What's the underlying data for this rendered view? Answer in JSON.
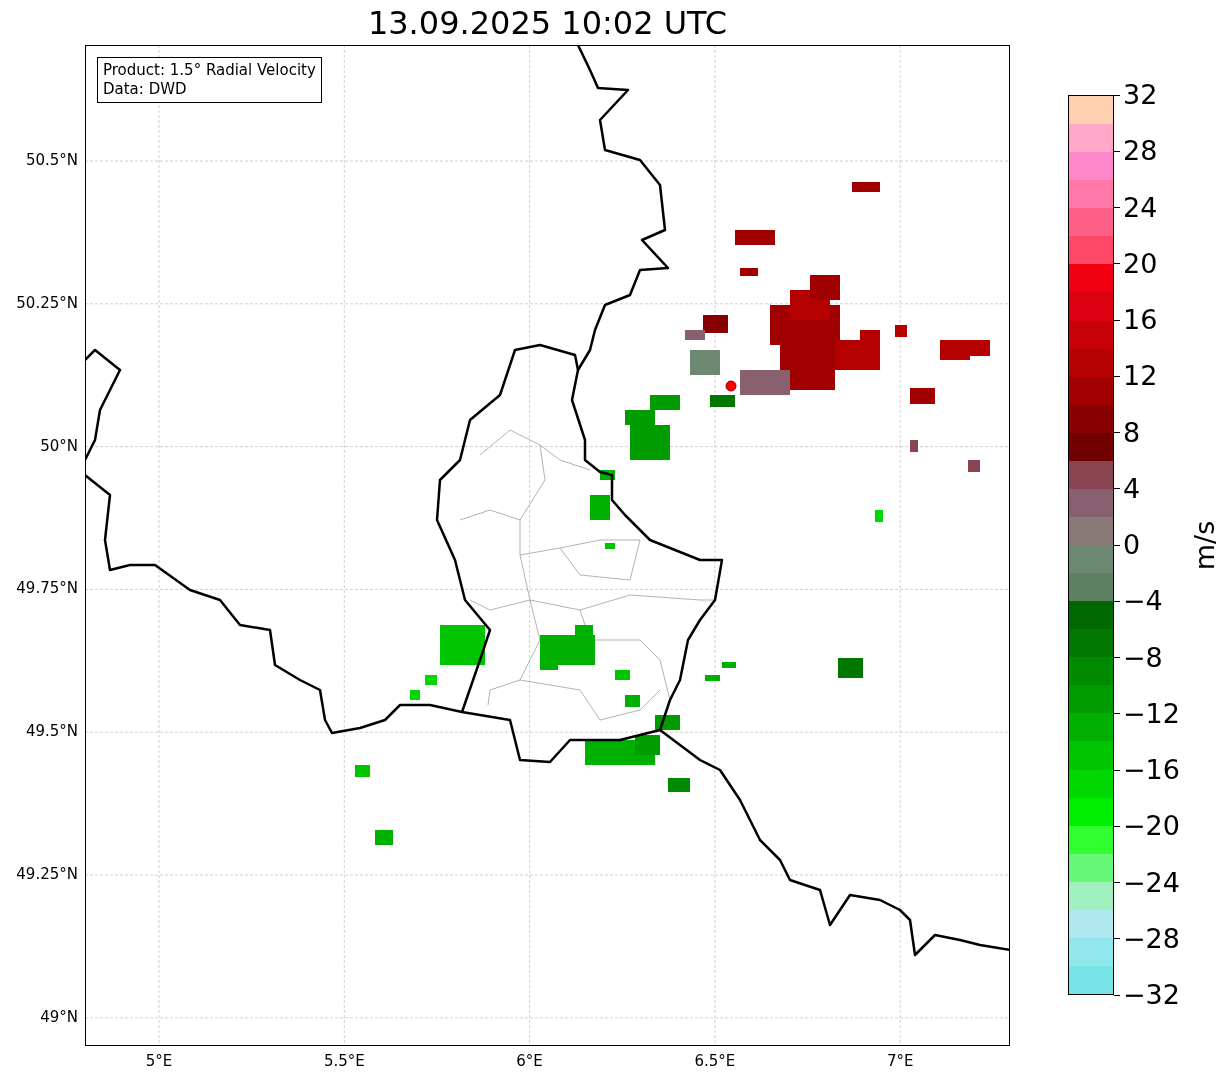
{
  "title": "13.09.2025 10:02 UTC",
  "info_box": {
    "lines": [
      "Product: 1.5° Radial Velocity",
      "Data: DWD"
    ]
  },
  "map": {
    "lat_labels": [
      "50.5°N",
      "50.25°N",
      "50°N",
      "49.75°N",
      "49.5°N",
      "49.25°N",
      "49°N"
    ],
    "lon_labels": [
      "5°E",
      "5.5°E",
      "6°E",
      "6.5°E",
      "7°E"
    ]
  },
  "colorbar": {
    "label": "m/s",
    "ticks": [
      "32",
      "28",
      "24",
      "20",
      "16",
      "12",
      "8",
      "4",
      "0",
      "−4",
      "−8",
      "−12",
      "−16",
      "−20",
      "−24",
      "−28",
      "−32"
    ],
    "bands": [
      {
        "color": "#ffd0b0"
      },
      {
        "color": "#ffa8c8"
      },
      {
        "color": "#ff88cc"
      },
      {
        "color": "#ff78a8"
      },
      {
        "color": "#ff6088"
      },
      {
        "color": "#ff4868"
      },
      {
        "color": "#f00010"
      },
      {
        "color": "#dc0010"
      },
      {
        "color": "#c80008"
      },
      {
        "color": "#b40000"
      },
      {
        "color": "#a00000"
      },
      {
        "color": "#880000"
      },
      {
        "color": "#700000"
      },
      {
        "color": "#884450"
      },
      {
        "color": "#886070"
      },
      {
        "color": "#887878"
      },
      {
        "color": "#6c8870"
      },
      {
        "color": "#5c8060"
      },
      {
        "color": "#006800"
      },
      {
        "color": "#007800"
      },
      {
        "color": "#008a00"
      },
      {
        "color": "#009c00"
      },
      {
        "color": "#00b000"
      },
      {
        "color": "#00c400"
      },
      {
        "color": "#00d800"
      },
      {
        "color": "#00f000"
      },
      {
        "color": "#30ff30"
      },
      {
        "color": "#68f878"
      },
      {
        "color": "#a0f0c0"
      },
      {
        "color": "#b0e8f0"
      },
      {
        "color": "#90e8ec"
      },
      {
        "color": "#78e4e8"
      }
    ]
  }
}
